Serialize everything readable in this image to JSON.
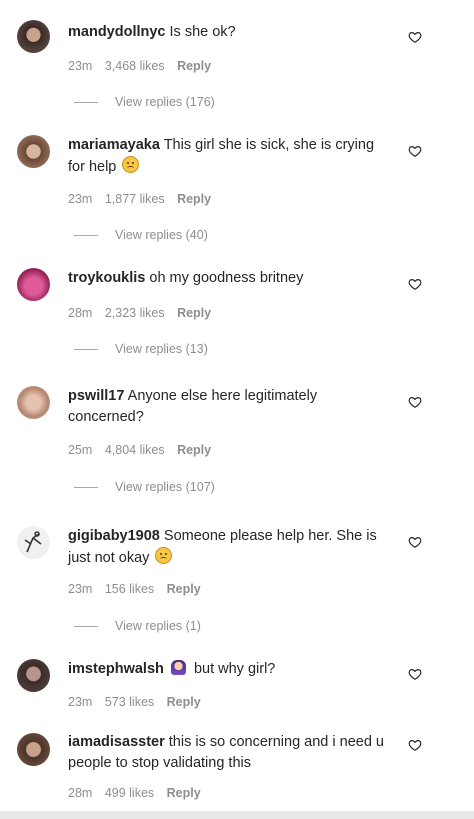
{
  "comments": [
    {
      "username": "mandydollnyc",
      "text": "Is she ok?",
      "time": "23m",
      "likes": "3,468 likes",
      "reply": "Reply",
      "view_replies": "View replies (176)",
      "avatar_color": "#6b5a52"
    },
    {
      "username": "mariamayaka",
      "text": "This girl she is sick, she is crying for help",
      "time": "23m",
      "likes": "1,877 likes",
      "reply": "Reply",
      "view_replies": "View replies (40)",
      "avatar_color": "#a9876f"
    },
    {
      "username": "troykouklis",
      "text": "oh my goodness britney",
      "time": "28m",
      "likes": "2,323 likes",
      "reply": "Reply",
      "view_replies": "View replies (13)",
      "avatar_color": "#c2337a"
    },
    {
      "username": "pswill17",
      "text": "Anyone else here legitimately concerned?",
      "time": "25m",
      "likes": "4,804 likes",
      "reply": "Reply",
      "view_replies": "View replies (107)",
      "avatar_color": "#c79a86"
    },
    {
      "username": "gigibaby1908",
      "text": "Someone please help her. She is just not okay",
      "time": "23m",
      "likes": "156 likes",
      "reply": "Reply",
      "view_replies": "View replies (1)",
      "avatar_color": "#dcdcdc"
    },
    {
      "username": "imstephwalsh",
      "text": "but why girl?",
      "time": "23m",
      "likes": "573 likes",
      "reply": "Reply",
      "avatar_color": "#5a4642"
    },
    {
      "username": "iamadisasster",
      "text": "this is so concerning and i need u people to stop validating this",
      "time": "28m",
      "likes": "499 likes",
      "reply": "Reply",
      "avatar_color": "#7b5a48"
    }
  ],
  "icons": {
    "like": "heart-outline-icon",
    "crying_emoji": "crying-face-emoji",
    "person_emoji": "person-emoji"
  }
}
